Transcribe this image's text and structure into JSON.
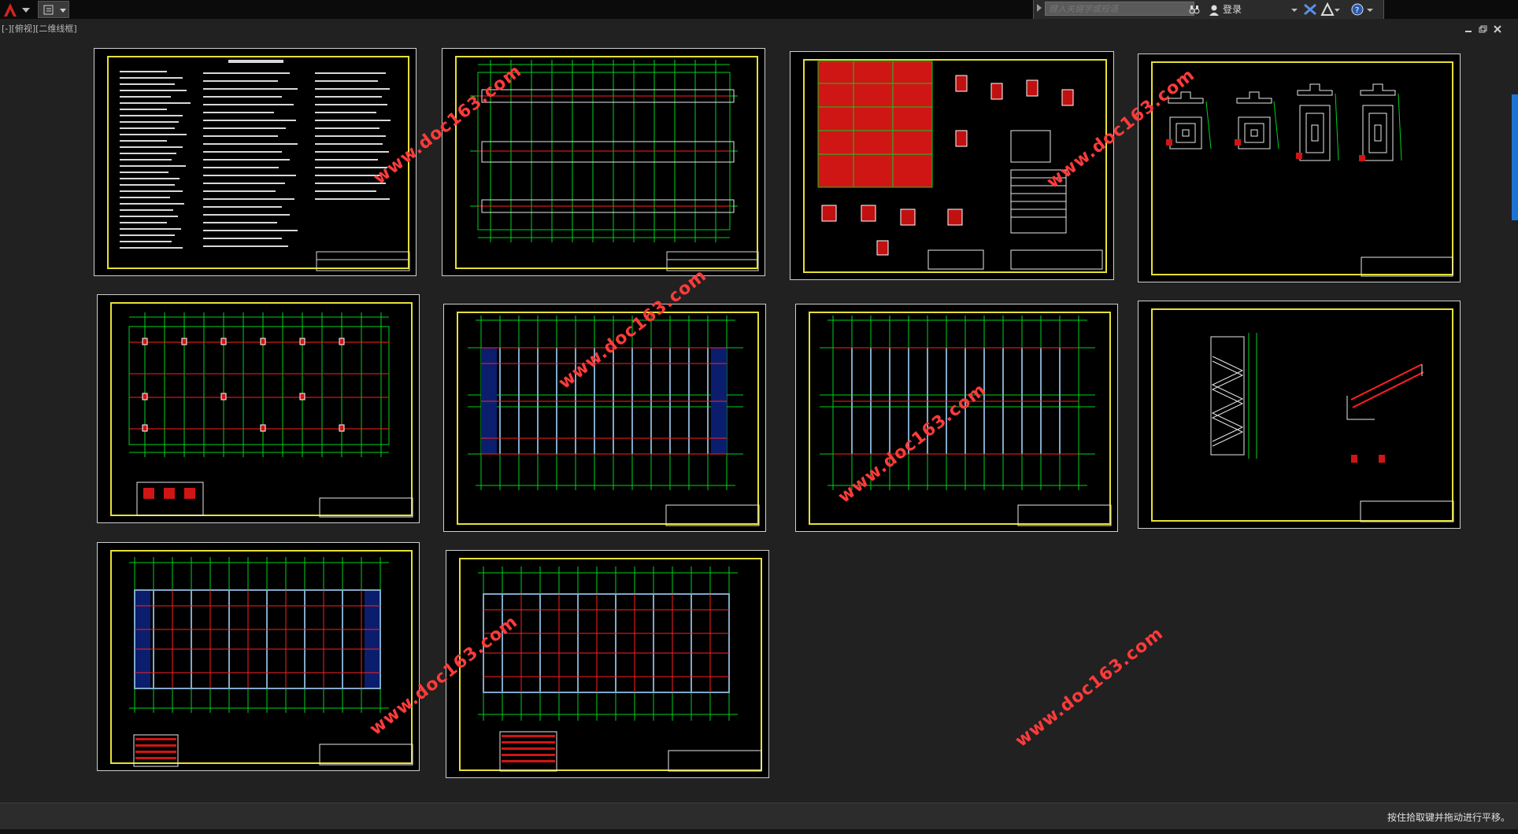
{
  "search": {
    "placeholder": "键入关键字或短语"
  },
  "toolbar": {
    "login_label": "登录"
  },
  "viewport": {
    "label": "[-][俯视][二维线框]"
  },
  "status": {
    "message": "按住拾取键并拖动进行平移。"
  },
  "watermark": {
    "text": "www.doc163.com"
  },
  "colors": {
    "background": "#212121",
    "frame": "#e6e035",
    "grid": "#00d21e",
    "beam": "#ff2020",
    "watermark": "#ff3b3b"
  },
  "icons": [
    "autocad-logo-icon",
    "quick-access-icon",
    "binoculars-icon",
    "user-icon",
    "exchange-icon",
    "a360-icon",
    "help-icon",
    "minimize-icon",
    "restore-icon",
    "close-icon"
  ]
}
